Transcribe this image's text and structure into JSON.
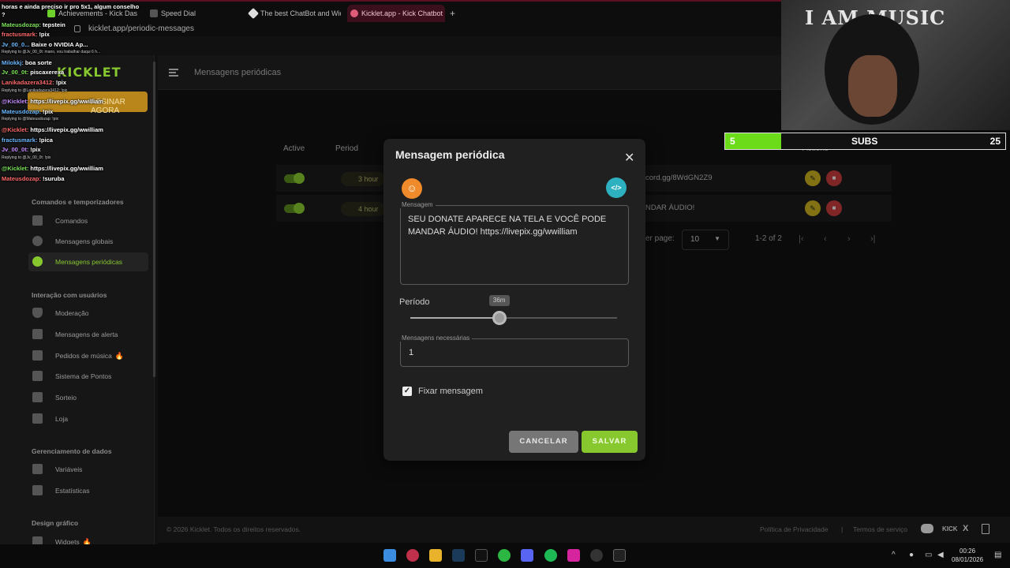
{
  "browser": {
    "tabs": [
      {
        "label": "Achievements - Kick Dash",
        "active": false
      },
      {
        "label": "Speed Dial",
        "active": false
      },
      {
        "label": "The best ChatBot and Wid",
        "active": false
      },
      {
        "label": "Kicklet.app - Kick Chatbot",
        "active": true
      }
    ],
    "url": "kicklet.app/periodic-messages"
  },
  "header": {
    "title": "Mensagens periódicas"
  },
  "sidebar": {
    "logo": "KICKLET",
    "cta": "ASSINAR AGORA",
    "sections": [
      {
        "title": "Comandos e temporizadores",
        "items": [
          {
            "label": "Comandos",
            "icon": "wrench-icon"
          },
          {
            "label": "Mensagens globais",
            "icon": "chat-bubble-icon"
          },
          {
            "label": "Mensagens periódicas",
            "icon": "clock-icon",
            "active": true
          }
        ]
      },
      {
        "title": "Interação com usuários",
        "items": [
          {
            "label": "Moderação",
            "icon": "shield-icon"
          },
          {
            "label": "Mensagens de alerta",
            "icon": "warning-icon"
          },
          {
            "label": "Pedidos de música",
            "icon": "music-note-icon",
            "badge": "🔥"
          },
          {
            "label": "Sistema de Pontos",
            "icon": "star-icon"
          },
          {
            "label": "Sorteio",
            "icon": "gift-icon"
          },
          {
            "label": "Loja",
            "icon": "cart-icon"
          }
        ]
      },
      {
        "title": "Gerenciamento de dados",
        "items": [
          {
            "label": "Variáveis",
            "icon": "link-icon"
          },
          {
            "label": "Estatísticas",
            "icon": "bar-chart-icon"
          }
        ]
      },
      {
        "title": "Design gráfico",
        "items": [
          {
            "label": "Widgets",
            "icon": "widget-icon",
            "badge": "🔥"
          }
        ]
      }
    ]
  },
  "chat": [
    {
      "user": "",
      "text": "horas e ainda preciso ir pro 5x1, algum conselho",
      "reply": false
    },
    {
      "user": "",
      "text": "?",
      "reply": false
    },
    {
      "user": "Mateusdozap:",
      "text": "tepstein",
      "reply": false
    },
    {
      "user": "fractusmark:",
      "text": "!pix",
      "reply": false
    },
    {
      "user": "Jv_00_0...",
      "text": "Baixe o NVIDIA Ap...",
      "reply": false
    },
    {
      "user": "",
      "text": "Replying to @Jv_00_0t: mano, vou trabalhar daqui 6 h...",
      "reply": true
    },
    {
      "user": "Milokkj:",
      "text": "boa sorte",
      "reply": false
    },
    {
      "user": "Jv_00_0t:",
      "text": "piscaxerexa",
      "reply": false
    },
    {
      "user": "Lanikadazera3412:",
      "text": "!pix",
      "reply": false
    },
    {
      "user": "",
      "text": "Replying to @Lanikadazera3412: !pix",
      "reply": true
    },
    {
      "user": "@Kicklet:",
      "text": "https://livepix.gg/wwilliam",
      "reply": false
    },
    {
      "user": "Mateusdozap:",
      "text": "!pix",
      "reply": false
    },
    {
      "user": "",
      "text": "Replying to @Mateusdozap: !pix",
      "reply": true
    },
    {
      "user": "@Kicklet:",
      "text": "https://livepix.gg/wwilliam",
      "reply": false
    },
    {
      "user": "fractusmark:",
      "text": "!pica",
      "reply": false
    },
    {
      "user": "Jv_00_0t:",
      "text": "!pix",
      "reply": false
    },
    {
      "user": "",
      "text": "Replying to @Jv_00_0t: !pix",
      "reply": true
    },
    {
      "user": "@Kicklet:",
      "text": "https://livepix.gg/wwilliam",
      "reply": false
    },
    {
      "user": "Mateusdozap:",
      "text": "!suruba",
      "reply": false
    }
  ],
  "table": {
    "headers": {
      "active": "Active",
      "period": "Period",
      "actions": "Actions"
    },
    "rows": [
      {
        "period": "3 hour",
        "text": "cord.gg/8WdGN2Z9",
        "active": true
      },
      {
        "period": "4 hour",
        "text": "NDAR ÁUDIO!",
        "active": true
      }
    ],
    "per_page_label": "er page:",
    "per_page": "10",
    "range": "1-2 of 2"
  },
  "modal": {
    "title": "Mensagem periódica",
    "message_label": "Mensagem",
    "message": "SEU DONATE APARECE NA TELA E VOCÊ PODE MANDAR ÁUDIO! https://livepix.gg/wwilliam",
    "period_label": "Período",
    "period_value": "36m",
    "period_fraction": 0.43,
    "required_label": "Mensagens necessárias",
    "required_value": "1",
    "pin_label": "Fixar mensagem",
    "pin_checked": true,
    "cancel": "CANCELAR",
    "save": "SALVAR"
  },
  "overlay": {
    "poster": "I AM MUSIC",
    "subs_current": "5",
    "subs_label": "SUBS",
    "subs_goal": "25",
    "subs_fraction": 0.2
  },
  "footer": {
    "copyright": "© 2026 Kicklet. Todos os direitos reservados.",
    "privacy": "Política de Privacidade",
    "separator": "|",
    "terms": "Termos de serviço",
    "kick": "KICK",
    "x": "X"
  },
  "taskbar": {
    "time": "00:26",
    "date": "08/01/2026"
  },
  "colors": {
    "accent": "#87c82f",
    "cta": "#b8861a",
    "danger": "#c53b3b",
    "edit": "#c9b01f"
  }
}
